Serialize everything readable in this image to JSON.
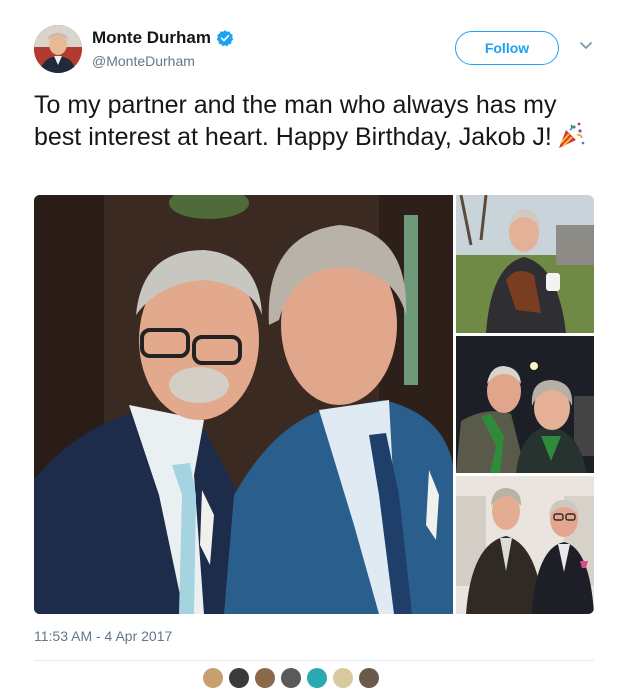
{
  "tweet": {
    "author": {
      "display_name": "Monte Durham",
      "handle": "@MonteDurham",
      "verified": true,
      "verified_icon": "verified-badge-icon"
    },
    "follow_label": "Follow",
    "menu_icon": "chevron-down-icon",
    "text": "To my partner and the man who always has my best interest at heart. Happy Birthday, Jakob J!",
    "emoji": "party-popper-icon",
    "photos": [
      {
        "name": "photo-main",
        "icon": "couple-photo"
      },
      {
        "name": "photo-side-1",
        "icon": "man-with-dog-photo"
      },
      {
        "name": "photo-side-2",
        "icon": "night-selfie-photo"
      },
      {
        "name": "photo-side-3",
        "icon": "formal-portrait-photo"
      }
    ],
    "timestamp": "11:53 AM - 4 Apr 2017"
  },
  "colors": {
    "accent": "#1da1f2",
    "text": "#14171a",
    "muted": "#657786",
    "divider": "#e6ecf0"
  }
}
